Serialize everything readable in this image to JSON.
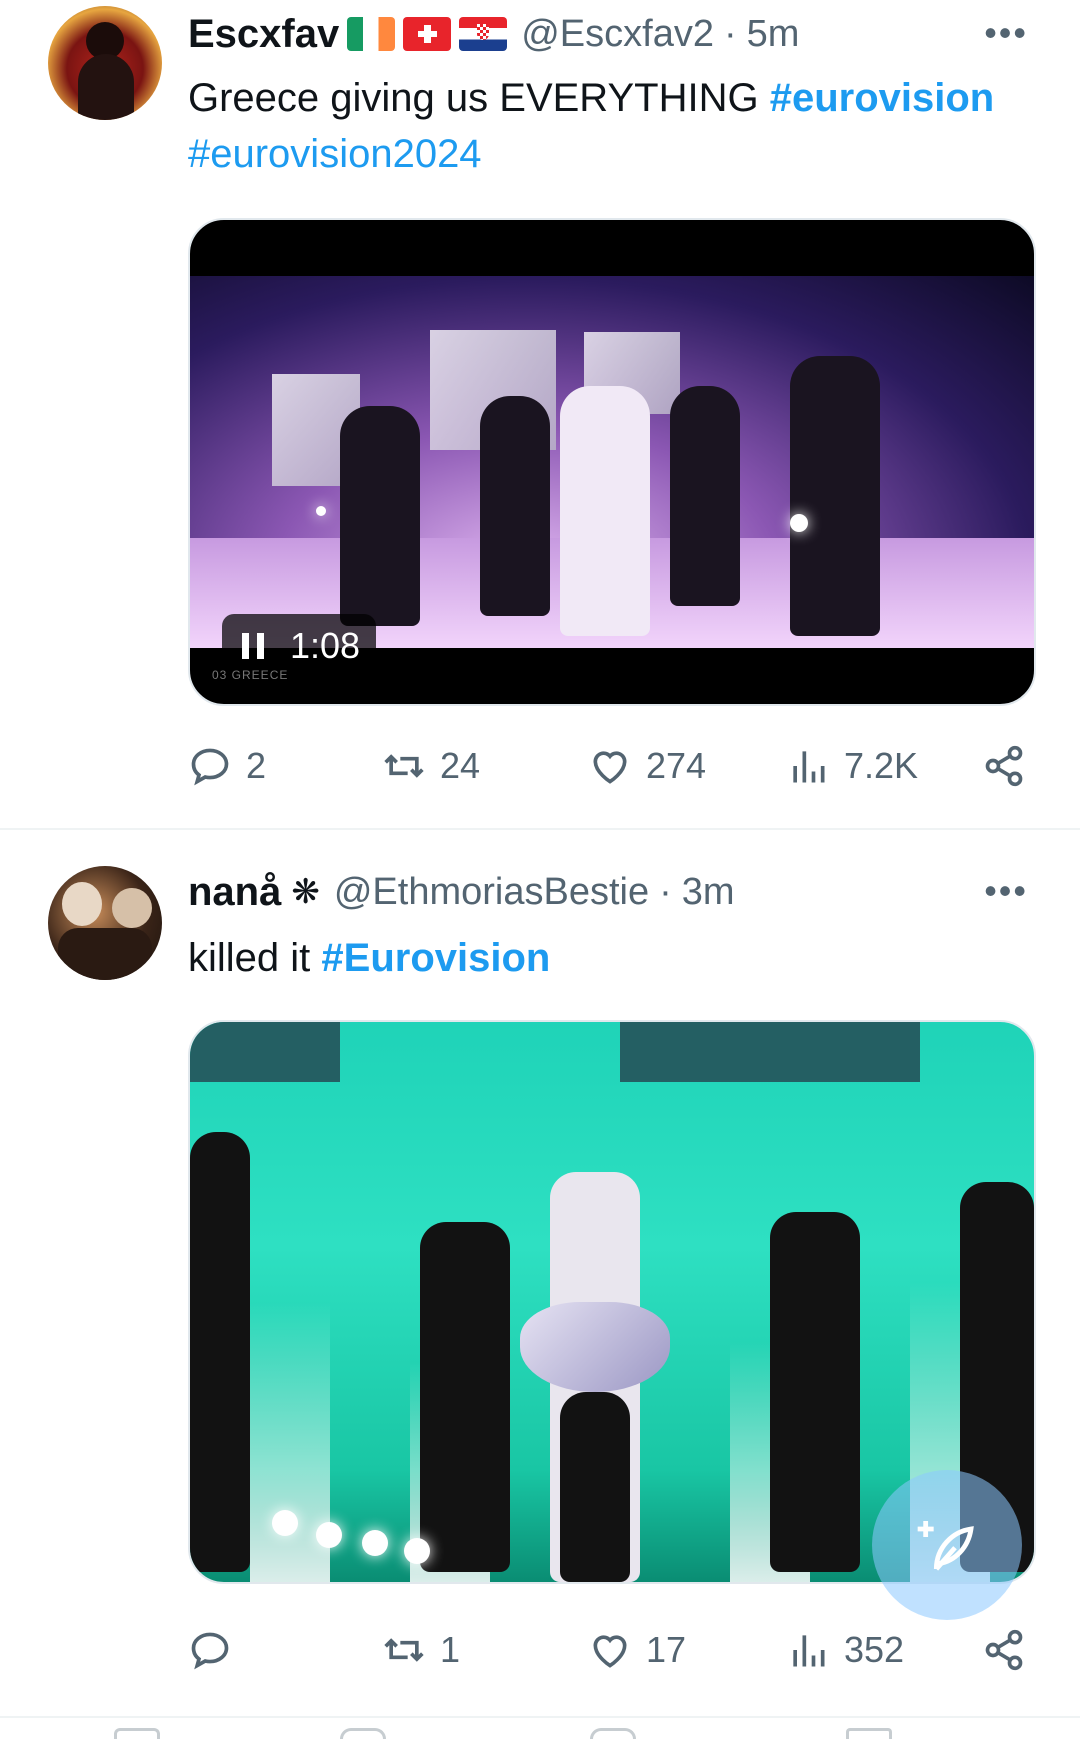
{
  "tweets": [
    {
      "display_name": "Escxfav",
      "flags": [
        "ireland-flag-icon",
        "switzerland-flag-icon",
        "croatia-flag-icon"
      ],
      "handle": "@Escxfav2",
      "time": "5m",
      "separator": "·",
      "text_plain": "Greece giving us EVERYTHING ",
      "hashtags": [
        "#eurovision",
        "#eurovision2024"
      ],
      "media": {
        "type": "video",
        "timestamp": "1:08",
        "overlay_caption": "03 GREECE"
      },
      "stats": {
        "replies": "2",
        "reposts": "24",
        "likes": "274",
        "views": "7.2K"
      }
    },
    {
      "display_name": "nanå",
      "name_glyph": "❋",
      "handle": "@EthmoriasBestie",
      "time": "3m",
      "separator": "·",
      "text_plain": "killed it ",
      "hashtags": [
        "#Eurovision"
      ],
      "media": {
        "type": "image"
      },
      "stats": {
        "replies": "",
        "reposts": "1",
        "likes": "17",
        "views": "352"
      }
    }
  ],
  "more_glyph": "•••",
  "colors": {
    "accent": "#1d9bf0",
    "secondary_text": "#536471",
    "primary_text": "#0f1419"
  },
  "icons": [
    "reply-icon",
    "repost-icon",
    "like-icon",
    "views-icon",
    "share-icon",
    "compose-icon"
  ]
}
